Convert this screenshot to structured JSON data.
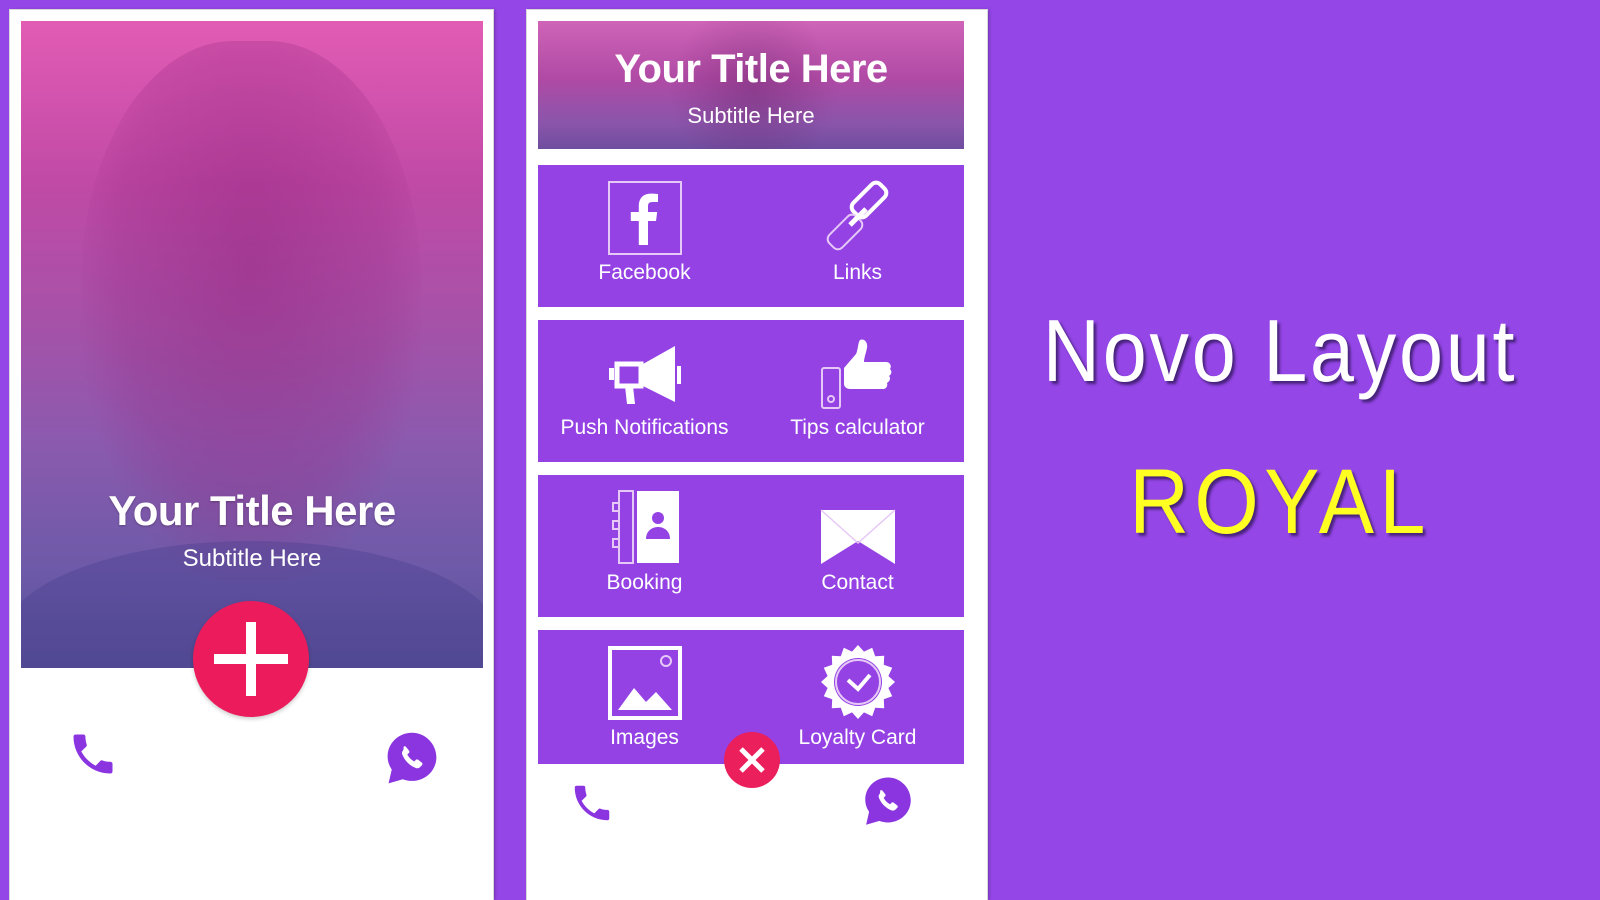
{
  "colors": {
    "background": "#9446e6",
    "tile": "#9442e4",
    "fab": "#ec1c5c",
    "icon_purple": "#8a35e0",
    "promo_highlight": "#ffff22"
  },
  "phone1": {
    "title": "Your Title Here",
    "subtitle": "Subtitle Here",
    "fab_icon": "plus-icon",
    "bottom_bar": {
      "left_icon": "phone-icon",
      "right_icon": "whatsapp-icon"
    }
  },
  "phone2": {
    "title": "Your Title Here",
    "subtitle": "Subtitle Here",
    "tiles": [
      {
        "label": "Facebook",
        "icon": "facebook-icon"
      },
      {
        "label": "Links",
        "icon": "link-icon"
      },
      {
        "label": "Push Notifications",
        "icon": "megaphone-icon"
      },
      {
        "label": "Tips calculator",
        "icon": "thumbs-up-icon"
      },
      {
        "label": "Booking",
        "icon": "address-book-icon"
      },
      {
        "label": "Contact",
        "icon": "envelope-icon"
      },
      {
        "label": "Images",
        "icon": "image-icon"
      },
      {
        "label": "Loyalty Card",
        "icon": "badge-check-icon"
      }
    ],
    "fab_icon": "close-icon",
    "bottom_bar": {
      "left_icon": "phone-icon",
      "right_icon": "whatsapp-icon"
    }
  },
  "promo": {
    "line1": "Novo Layout",
    "line2": "ROYAL"
  }
}
